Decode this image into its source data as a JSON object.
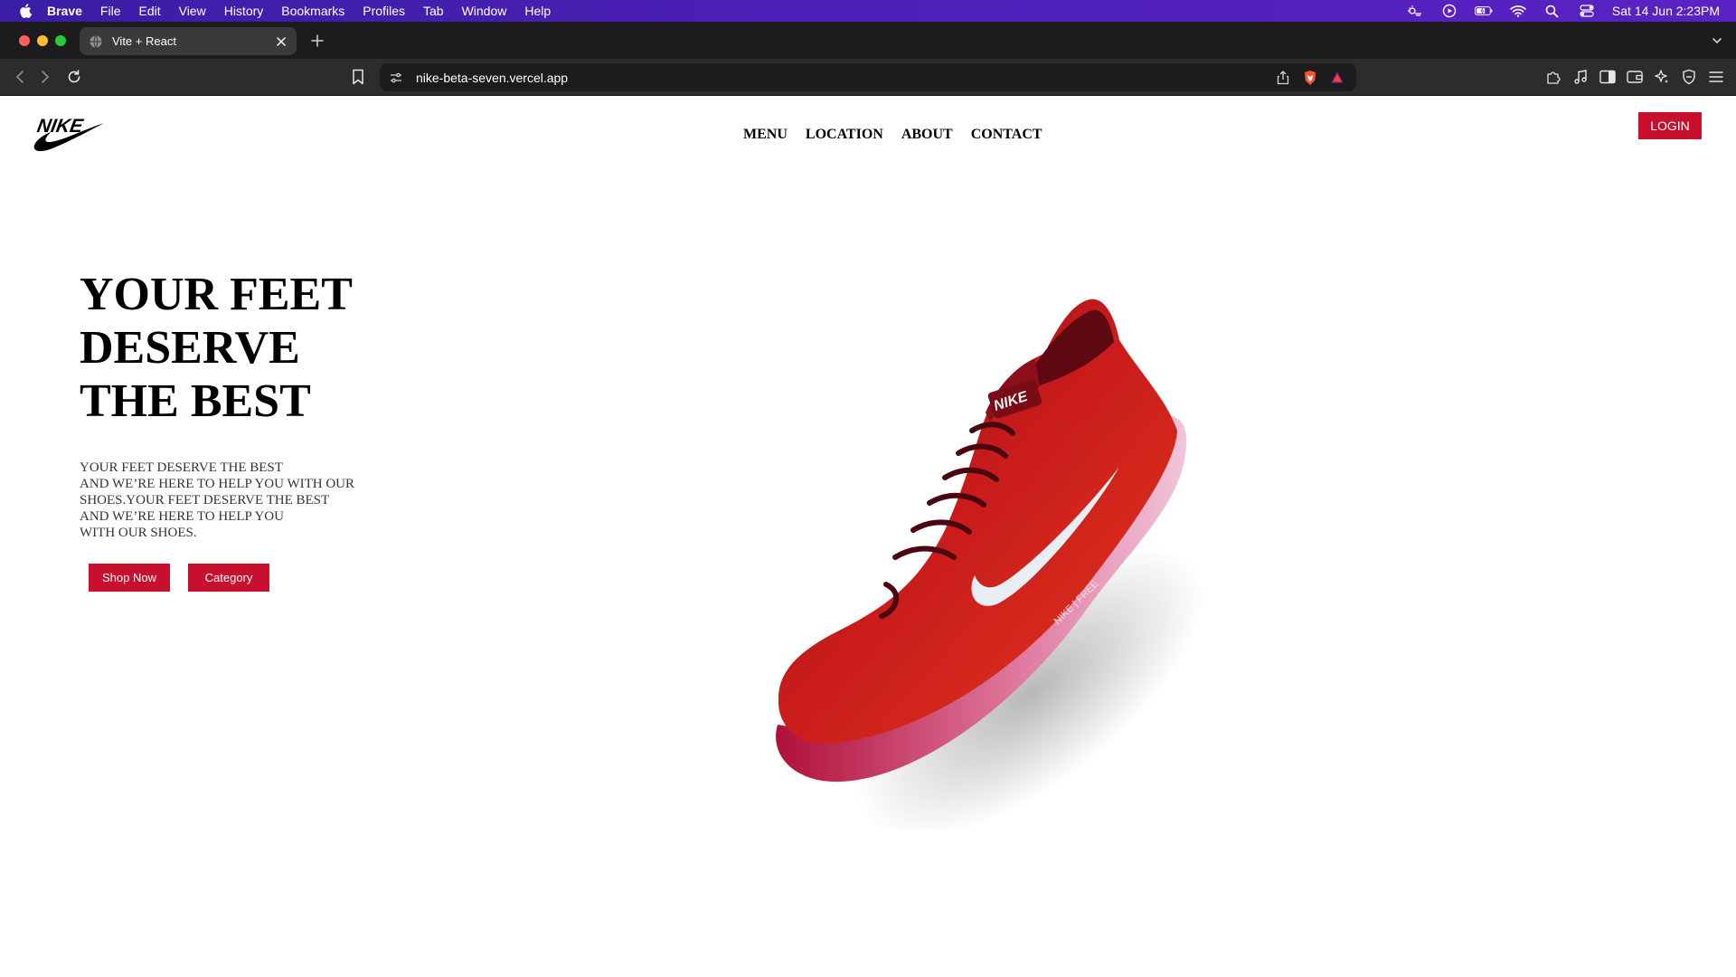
{
  "menubar": {
    "app_name": "Brave",
    "items": [
      "File",
      "Edit",
      "View",
      "History",
      "Bookmarks",
      "Profiles",
      "Tab",
      "Window",
      "Help"
    ],
    "clock": "Sat 14 Jun  2:23PM",
    "status_icons": [
      "weather-icon",
      "play-circle-icon",
      "battery-icon",
      "wifi-icon",
      "search-icon",
      "control-center-icon"
    ]
  },
  "browser": {
    "tab_title": "Vite + React",
    "url": "nike-beta-seven.vercel.app"
  },
  "site": {
    "logo_text": "NIKE",
    "nav": [
      "MENU",
      "LOCATION",
      "ABOUT",
      "CONTACT"
    ],
    "login_label": "LOGIN",
    "hero_title_lines": [
      "YOUR FEET",
      "DESERVE",
      "THE BEST"
    ],
    "hero_text_lines": [
      "YOUR FEET DESERVE THE BEST",
      "AND WE’RE HERE TO HELP YOU WITH OUR",
      "SHOES.YOUR FEET DESERVE THE BEST",
      "AND WE’RE HERE TO HELP YOU",
      "WITH OUR SHOES."
    ],
    "shop_now_label": "Shop Now",
    "category_label": "Category",
    "product_image": "red-running-shoe"
  },
  "colors": {
    "accent": "#c8102e",
    "menubar": "#4b1fb5",
    "chrome_dark": "#1c1c1e"
  }
}
